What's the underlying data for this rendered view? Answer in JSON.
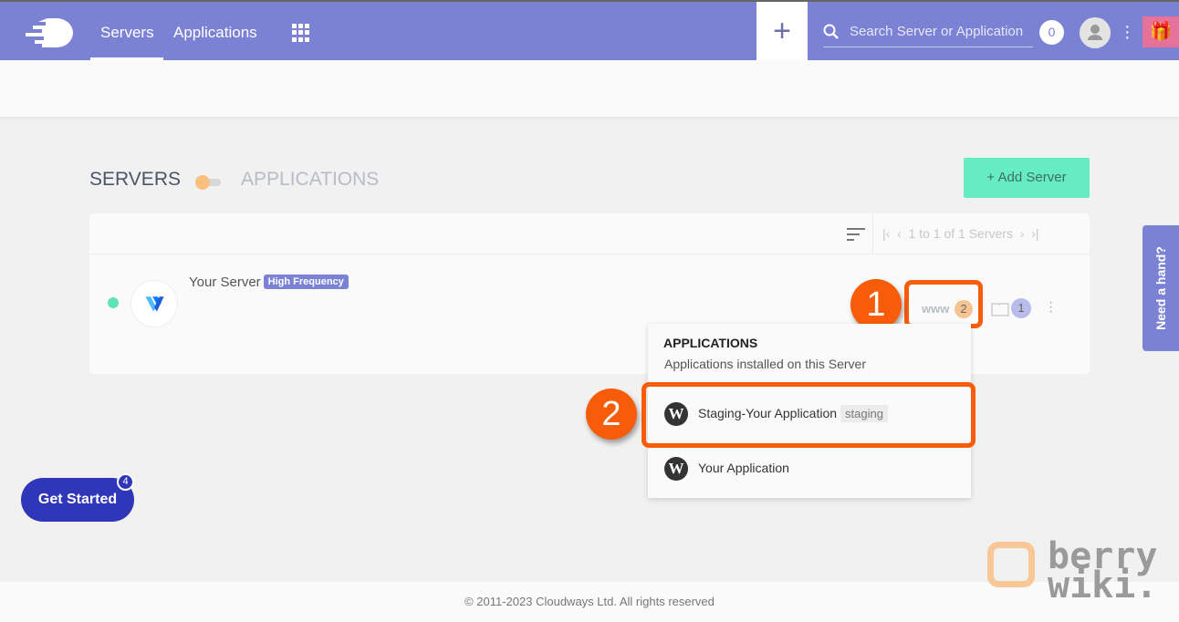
{
  "topbar": {
    "nav": [
      "Servers",
      "Applications"
    ],
    "search_placeholder": "Search Server or Application",
    "notification_count": "0",
    "plus": "+"
  },
  "page": {
    "servers_heading": "SERVERS",
    "applications_heading": "APPLICATIONS",
    "add_server": "+ Add Server"
  },
  "list": {
    "pagination": "1 to 1 of 1 Servers",
    "server": {
      "name": "Your Server",
      "badge": "High Frequency",
      "status": "running",
      "www_label": "www",
      "app_count": "2",
      "project_count": "1"
    }
  },
  "dropdown": {
    "title": "APPLICATIONS",
    "subtitle": "Applications installed on this Server",
    "items": [
      {
        "name": "Staging-Your Application",
        "tag": "staging"
      },
      {
        "name": "Your Application",
        "tag": ""
      }
    ]
  },
  "annotations": [
    "1",
    "2"
  ],
  "help": "Need a hand?",
  "get_started": {
    "label": "Get Started",
    "badge": "4"
  },
  "footer": "© 2011-2023 Cloudways Ltd. All rights reserved",
  "watermark": {
    "line1": "berry",
    "line2": "wiki."
  },
  "colors": {
    "brand": "#7b82d4",
    "accent": "#65ecc2",
    "highlight": "#f75c0a",
    "status": "#5ee3b7"
  }
}
